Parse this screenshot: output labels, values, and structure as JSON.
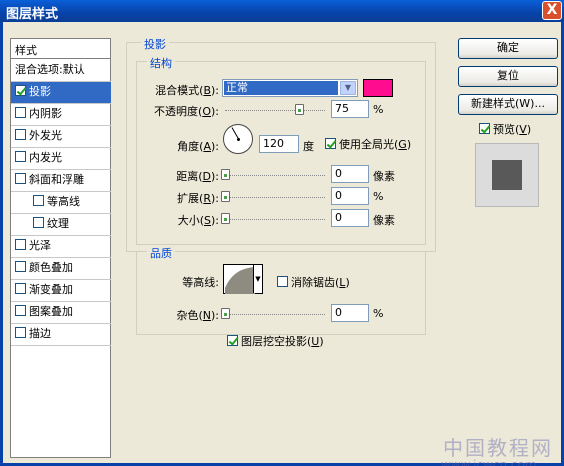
{
  "window": {
    "title": "图层样式",
    "close": "X"
  },
  "left_panel": {
    "header": "样式",
    "items": [
      {
        "label": "混合选项:默认",
        "checkbox": false
      },
      {
        "label": "投影",
        "checkbox": true,
        "checked": true,
        "selected": true
      },
      {
        "label": "内阴影",
        "checkbox": true
      },
      {
        "label": "外发光",
        "checkbox": true
      },
      {
        "label": "内发光",
        "checkbox": true
      },
      {
        "label": "斜面和浮雕",
        "checkbox": true
      },
      {
        "label": "等高线",
        "checkbox": true,
        "sub": true
      },
      {
        "label": "纹理",
        "checkbox": true,
        "sub": true
      },
      {
        "label": "光泽",
        "checkbox": true
      },
      {
        "label": "颜色叠加",
        "checkbox": true
      },
      {
        "label": "渐变叠加",
        "checkbox": true
      },
      {
        "label": "图案叠加",
        "checkbox": true
      },
      {
        "label": "描边",
        "checkbox": true
      }
    ]
  },
  "shadow": {
    "group_title": "投影",
    "structure_title": "结构",
    "blend_mode_label": "混合模式",
    "blend_mode_hotkey": "B",
    "blend_mode_value": "正常",
    "shadow_color": "#ff0c8f",
    "opacity_label": "不透明度",
    "opacity_hotkey": "O",
    "opacity_value": "75",
    "opacity_unit": "%",
    "opacity_level": 0.75,
    "angle_label": "角度",
    "angle_hotkey": "A",
    "angle_value": "120",
    "angle_unit": "度",
    "use_global_light_label": "使用全局光",
    "use_global_light_hotkey": "G",
    "use_global_light": true,
    "distance_label": "距离",
    "distance_hotkey": "D",
    "distance_value": "0",
    "distance_unit": "像素",
    "spread_label": "扩展",
    "spread_hotkey": "R",
    "spread_value": "0",
    "spread_unit": "%",
    "size_label": "大小",
    "size_hotkey": "S",
    "size_value": "0",
    "size_unit": "像素"
  },
  "quality": {
    "title": "品质",
    "contour_label": "等高线",
    "anti_alias_label": "消除锯齿",
    "anti_alias_hotkey": "L",
    "anti_alias": false,
    "noise_label": "杂色",
    "noise_hotkey": "N",
    "noise_value": "0",
    "noise_unit": "%",
    "knockout_label": "图层挖空投影",
    "knockout_hotkey": "U",
    "knockout": true
  },
  "buttons": {
    "ok": "确定",
    "reset": "复位",
    "new_style": "新建样式(W)...",
    "preview_label": "预览",
    "preview_hotkey": "V",
    "preview_checked": true
  },
  "watermark": {
    "line1": "中国教程网",
    "line2": "www.jcwcn.com"
  }
}
